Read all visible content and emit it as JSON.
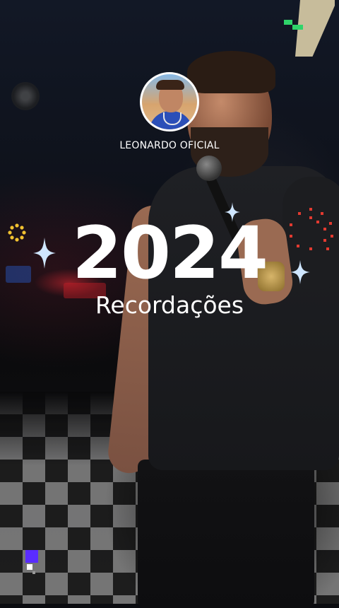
{
  "profile": {
    "username": "LEONARDO OFICIAL"
  },
  "memories": {
    "year": "2024",
    "subtitle": "Recordações"
  },
  "colors": {
    "sparkle": "#cfe6ff",
    "sun": "#f2c230",
    "burst": "#e23a30",
    "pixel_green": "#2fd46a",
    "pixel_purple": "#5a2cff"
  },
  "icons": [
    "sparkle-icon",
    "sun-icon",
    "firework-icon",
    "pixel-decoration-icon"
  ]
}
